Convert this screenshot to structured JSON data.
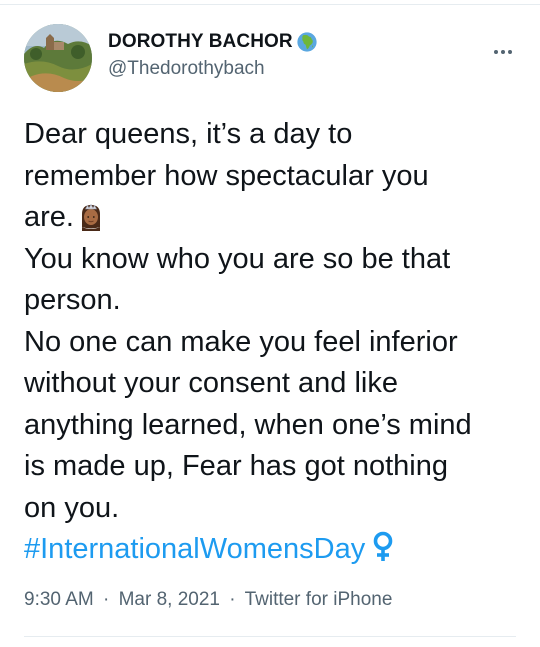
{
  "tweet": {
    "author": {
      "display_name": "DOROTHY BACHOR",
      "handle": "@Thedorothybach",
      "name_emoji_icon": "globe-africa-icon",
      "avatar_icon": "landscape-photo-avatar"
    },
    "more_icon": "ellipsis-icon",
    "body_lines": [
      "Dear queens, it’s a day to",
      "remember how spectacular you",
      "are.",
      "You know who you are so be that",
      "person.",
      "No one can make you feel inferior",
      "without your consent and like",
      "anything learned, when one’s mind",
      "is made up, Fear has got nothing",
      "on you."
    ],
    "inline_emoji": "princess-crown-emoji-icon",
    "hashtag": "#InternationalWomensDay",
    "hashtag_emoji": "female-sign-icon",
    "colors": {
      "text": "#0f1419",
      "secondary": "#536471",
      "link": "#1d9bf0",
      "venus": "#1d9bf0"
    },
    "meta": {
      "time": "9:30 AM",
      "date": "Mar 8, 2021",
      "separator": "·",
      "source": "Twitter for iPhone"
    }
  }
}
